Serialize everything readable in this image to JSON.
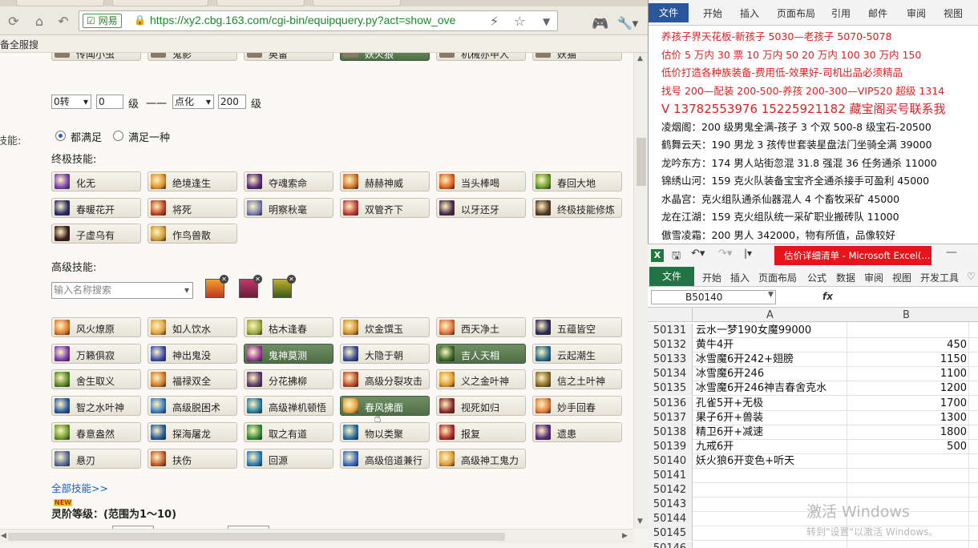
{
  "browser": {
    "url_badge": "网易",
    "url": "https://xy2.cbg.163.com/cgi-bin/equipquery.py?act=show_ove",
    "bookmark": "备全服搜"
  },
  "filters": {
    "level_turn": "0转",
    "level_min": "0",
    "level_word1": "级",
    "level_dash": "一一",
    "level_turn2": "点化",
    "level_max": "200",
    "level_word2": "级",
    "skill_label": "技能:",
    "radio_all": "都满足",
    "radio_any": "满足一种",
    "ultimate_title": "终极技能:",
    "advanced_title": "高级技能:",
    "search_placeholder": "输入名称搜索",
    "all_skills_link": "全部技能>>",
    "new_badge": "NEW",
    "lingjie_title": "灵阶等级：(范围为1～10)"
  },
  "top_row": [
    "传闻小虫",
    "鬼影",
    "英雷",
    "妖火狼",
    "机械亦甲人",
    "妖猫"
  ],
  "ultimate_skills": [
    {
      "label": "化无",
      "color": "#7a3fb0"
    },
    {
      "label": "绝境逢生",
      "color": "#e0902a"
    },
    {
      "label": "夺魂索命",
      "color": "#5a2a7a"
    },
    {
      "label": "赫赫神威",
      "color": "#d0702a"
    },
    {
      "label": "当头棒喝",
      "color": "#e06020"
    },
    {
      "label": "春回大地",
      "color": "#6a9a2a"
    },
    {
      "label": "春暖花开",
      "color": "#2a2a6a"
    },
    {
      "label": "将死",
      "color": "#c04020"
    },
    {
      "label": "明察秋毫",
      "color": "#7a7ab0"
    },
    {
      "label": "双管齐下",
      "color": "#c03a3a"
    },
    {
      "label": "以牙还牙",
      "color": "#4a2a4a"
    },
    {
      "label": "终极技能修炼",
      "color": "#5a3a2a"
    },
    {
      "label": "子虚乌有",
      "color": "#3a1a1a"
    },
    {
      "label": "作鸟兽散",
      "color": "#d09a3a"
    }
  ],
  "advanced_skills": [
    {
      "label": "风火燎原",
      "color": "#e07a2a"
    },
    {
      "label": "如人饮水",
      "color": "#e0a040"
    },
    {
      "label": "枯木逢春",
      "color": "#9aaa3a"
    },
    {
      "label": "炊金馔玉",
      "color": "#d09030"
    },
    {
      "label": "西天净土",
      "color": "#e0703a"
    },
    {
      "label": "五蕴皆空",
      "color": "#2a2a5a"
    },
    {
      "label": "万籁俱寂",
      "color": "#7a3ab0"
    },
    {
      "label": "神出鬼没",
      "color": "#3a4ab0"
    },
    {
      "label": "鬼神莫测",
      "color": "#9a3a9a",
      "selected": true
    },
    {
      "label": "大隐于朝",
      "color": "#3a4a9a"
    },
    {
      "label": "吉人天相",
      "color": "#3a6a2a",
      "selected": true
    },
    {
      "label": "云起潮生",
      "color": "#2a6a8a"
    },
    {
      "label": "舍生取义",
      "color": "#5a8a2a"
    },
    {
      "label": "福禄双全",
      "color": "#d07a2a"
    },
    {
      "label": "分花拂柳",
      "color": "#5a3a6a"
    },
    {
      "label": "高级分裂攻击",
      "color": "#c04a2a"
    },
    {
      "label": "义之金叶神",
      "color": "#e09a2a"
    },
    {
      "label": "信之土叶神",
      "color": "#8a6a2a"
    },
    {
      "label": "智之水叶神",
      "color": "#2a5aa0"
    },
    {
      "label": "高级脱困术",
      "color": "#3a7ac0"
    },
    {
      "label": "高级禅机顿悟",
      "color": "#2a7aa0"
    },
    {
      "label": "春风拂面",
      "color": "#e0a03a",
      "selected": true
    },
    {
      "label": "视死如归",
      "color": "#8a2a2a"
    },
    {
      "label": "妙手回春",
      "color": "#e07a3a"
    },
    {
      "label": "春意盎然",
      "color": "#6a9a2a"
    },
    {
      "label": "探海屠龙",
      "color": "#2a5a9a"
    },
    {
      "label": "取之有道",
      "color": "#3a8a3a"
    },
    {
      "label": "物以类聚",
      "color": "#2a6aa0"
    },
    {
      "label": "报复",
      "color": "#b02a2a"
    },
    {
      "label": "遗患",
      "color": "#5a2a7a"
    },
    {
      "label": "悬刃",
      "color": "#5a6a9a"
    },
    {
      "label": "扶伤",
      "color": "#c05a2a"
    },
    {
      "label": "回源",
      "color": "#2a7ab0"
    },
    {
      "label": "高级倍道兼行",
      "color": "#3a6ac0"
    },
    {
      "label": "高级神工鬼力",
      "color": "#e09a3a"
    }
  ],
  "word": {
    "tabs": [
      "文件",
      "开始",
      "插入",
      "页面布局",
      "引用",
      "邮件",
      "审阅",
      "视图"
    ],
    "lines": [
      {
        "text": "养孩子界天花板-新孩子 5030—老孩子 5070-5078",
        "color": "red"
      },
      {
        "text": "估价 5 万内 30 票  10 万内 50  20 万内 100  30 万内 150",
        "color": "red"
      },
      {
        "text": "低价打造各种族装备-费用低-效果好-司机出品必须精品",
        "color": "red"
      },
      {
        "text": "找号 200—配装 200-500-养孩 200-300—VIP520 超级 1314",
        "color": "red"
      },
      {
        "text": "V 13782553976   15225921182  藏宝阁买号联系我",
        "color": "red"
      },
      {
        "text": "凌烟阁：200 级男鬼全满-孩子 3 个双 500-8 级宝石-20500",
        "color": "blk"
      },
      {
        "text": "鹤舞云天：190 男龙 3 孩传世套装星盘法门坐骑全满 39000",
        "color": "blk"
      },
      {
        "text": "龙吟东方：174 男人站街忽混 31.8 强混 36 任务通杀 11000",
        "color": "blk"
      },
      {
        "text": "锦绣山河：159 克火队装备宝宝齐全通杀接手可盈利 45000",
        "color": "blk"
      },
      {
        "text": "水晶宫：克火组队通杀仙器混人 4 个畜牧采矿 45000",
        "color": "blk"
      },
      {
        "text": "龙在江湖：159 克火组队统一采矿职业搬砖队 11000",
        "color": "blk"
      },
      {
        "text": "傲雪凌霜：200 男人 342000，物有所值，品像较好",
        "color": "blk"
      }
    ]
  },
  "excel": {
    "title": "估价详细清单 - Microsoft Excel(...",
    "tabs": [
      "开始",
      "插入",
      "页面布局",
      "公式",
      "数据",
      "审阅",
      "视图",
      "开发工具"
    ],
    "file_label": "文件",
    "namebox": "B50140",
    "fx": "fx",
    "col_a": "A",
    "col_b": "B",
    "rows": [
      {
        "n": "50131",
        "a": "云水一梦190女魔99000",
        "b": ""
      },
      {
        "n": "50132",
        "a": "黄牛4开",
        "b": "450"
      },
      {
        "n": "50133",
        "a": "冰雪魔6开242+翅膀",
        "b": "1150"
      },
      {
        "n": "50134",
        "a": "冰雪魔6开246",
        "b": "1100"
      },
      {
        "n": "50135",
        "a": "冰雪魔6开246神吉春舍克水",
        "b": "1200"
      },
      {
        "n": "50136",
        "a": "孔雀5开+无极",
        "b": "1700"
      },
      {
        "n": "50137",
        "a": "果子6开+兽装",
        "b": "1300"
      },
      {
        "n": "50138",
        "a": "精卫6开+减速",
        "b": "1800"
      },
      {
        "n": "50139",
        "a": "九戒6开",
        "b": "500"
      },
      {
        "n": "50140",
        "a": "妖火狼6开变色+听天",
        "b": ""
      },
      {
        "n": "50141",
        "a": "",
        "b": ""
      },
      {
        "n": "50142",
        "a": "",
        "b": ""
      },
      {
        "n": "50143",
        "a": "",
        "b": ""
      },
      {
        "n": "50144",
        "a": "",
        "b": ""
      },
      {
        "n": "50145",
        "a": "",
        "b": ""
      },
      {
        "n": "50146",
        "a": "",
        "b": ""
      }
    ],
    "activate_title": "激活 Windows",
    "activate_sub": "转到\"设置\"以激活 Windows。"
  }
}
